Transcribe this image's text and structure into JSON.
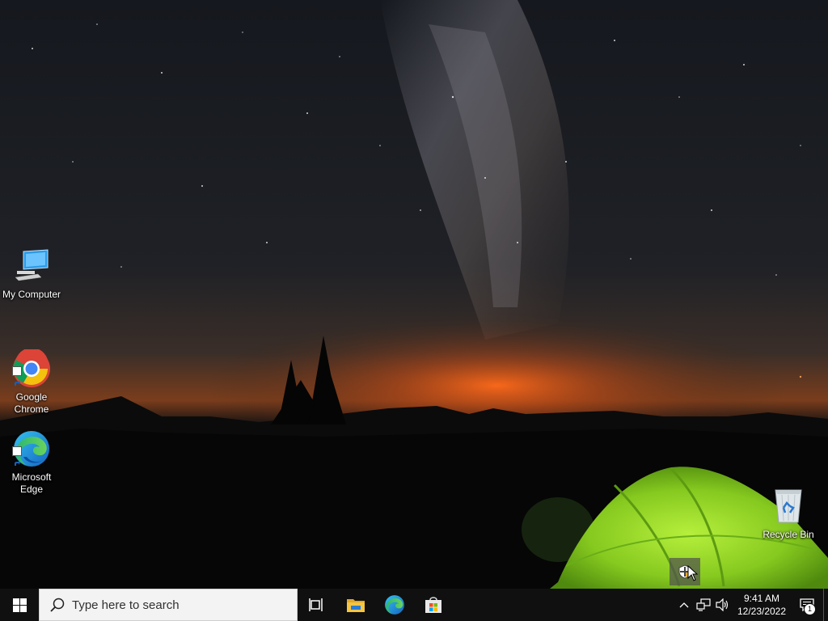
{
  "desktop": {
    "icons": [
      {
        "label": "My Computer",
        "icon": "monitor-icon"
      },
      {
        "label": "Google\nChrome",
        "icon": "chrome-icon"
      },
      {
        "label": "Microsoft\nEdge",
        "icon": "edge-icon"
      },
      {
        "label": "Recycle Bin",
        "icon": "recycle-bin-icon"
      }
    ],
    "tray_popup_icon": "shield-icon"
  },
  "taskbar": {
    "start_icon": "windows-logo-icon",
    "search_placeholder": "Type here to search",
    "pinned": [
      {
        "icon": "task-view-icon"
      },
      {
        "icon": "file-explorer-icon"
      },
      {
        "icon": "edge-icon"
      },
      {
        "icon": "microsoft-store-icon"
      }
    ],
    "tray": {
      "icons": [
        "chevron-up-icon",
        "network-icon",
        "volume-icon"
      ],
      "time": "9:41 AM",
      "date": "12/23/2022",
      "notification_count": "1"
    }
  },
  "colors": {
    "taskbar_bg": "#101010",
    "search_bg": "#f3f3f3",
    "tent_green": "#8fd12a",
    "horizon_orange": "#e8661c"
  }
}
